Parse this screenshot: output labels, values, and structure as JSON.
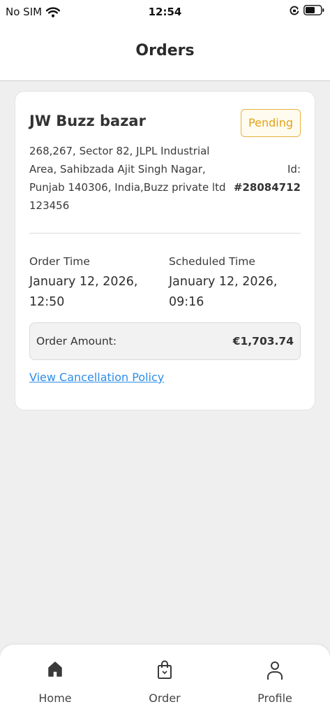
{
  "status_bar": {
    "carrier": "No SIM",
    "time": "12:54",
    "icons": [
      "wifi-icon",
      "orientation-lock-icon",
      "battery-icon"
    ]
  },
  "header": {
    "title": "Orders"
  },
  "order": {
    "store_name": "JW Buzz bazar",
    "status": "Pending",
    "address_lines": [
      "268,267, Sector 82, JLPL Industrial",
      "Area, Sahibzada Ajit Singh Nagar,",
      "Punjab 140306, India,Buzz private ltd",
      "123456"
    ],
    "id_label": "Id:",
    "id_value": "#28084712",
    "order_time_label": "Order Time",
    "order_time_date": "January 12, 2026,",
    "order_time_clock": "12:50",
    "scheduled_time_label": "Scheduled Time",
    "scheduled_time_date": "January 12, 2026,",
    "scheduled_time_clock": "09:16",
    "amount_label": "Order Amount:",
    "amount_value": "€1,703.74",
    "policy_link": "View Cancellation Policy"
  },
  "bottom_nav": {
    "items": [
      {
        "label": "Home",
        "icon": "home-icon"
      },
      {
        "label": "Order",
        "icon": "shopping-bag-icon"
      },
      {
        "label": "Profile",
        "icon": "person-icon"
      }
    ]
  },
  "colors": {
    "pending_text": "#e3a21a",
    "pending_border": "#e6b33f",
    "link": "#2e8de8",
    "background": "#efefef"
  }
}
